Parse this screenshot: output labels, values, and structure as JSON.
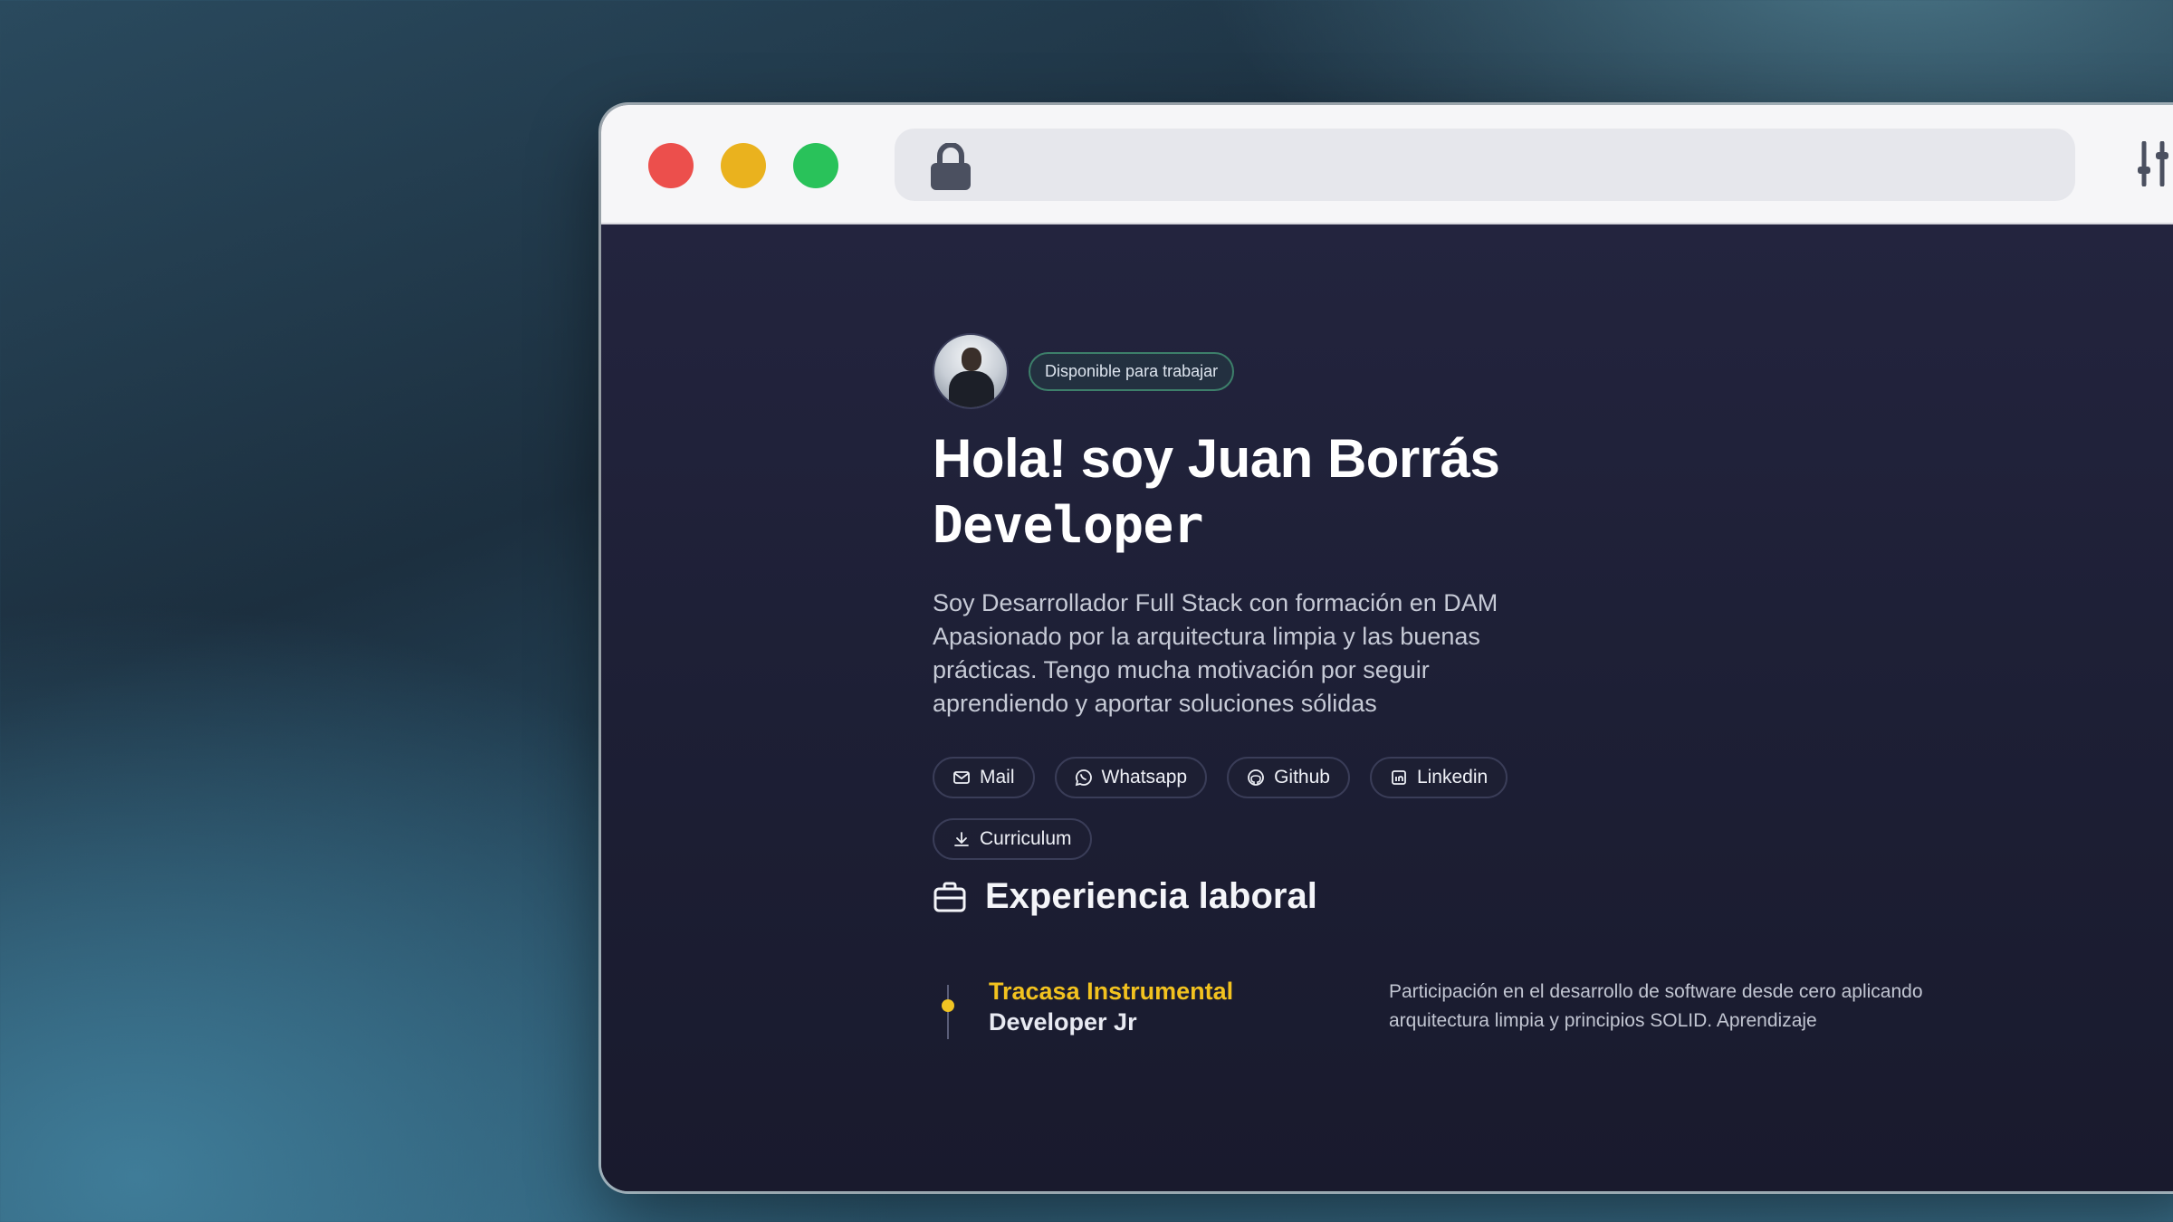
{
  "browser": {
    "window_controls": [
      "close",
      "minimize",
      "maximize"
    ],
    "url_icon": "lock-icon",
    "settings_icon": "sliders-icon"
  },
  "hero": {
    "status_badge": "Disponible para trabajar",
    "title": "Hola! soy Juan Borrás",
    "role": "Developer",
    "description": "Soy Desarrollador Full Stack con formación en DAM Apasionado por la arquitectura limpia y las buenas prácticas. Tengo mucha motivación por seguir aprendiendo y aportar soluciones sólidas",
    "links": [
      {
        "label": "Mail",
        "icon": "mail-icon"
      },
      {
        "label": "Whatsapp",
        "icon": "whatsapp-icon"
      },
      {
        "label": "Github",
        "icon": "github-icon"
      },
      {
        "label": "Linkedin",
        "icon": "linkedin-icon"
      },
      {
        "label": "Curriculum",
        "icon": "download-icon"
      }
    ]
  },
  "experience": {
    "title": "Experiencia laboral",
    "jobs": [
      {
        "company": "Tracasa Instrumental",
        "role": "Developer Jr",
        "description": "Participación en el desarrollo de software desde cero aplicando arquitectura limpia y principios SOLID. Aprendizaje"
      }
    ]
  },
  "colors": {
    "accent": "#f2c21f",
    "badge_border": "#3d7f6a",
    "background": "#1e1f36"
  }
}
